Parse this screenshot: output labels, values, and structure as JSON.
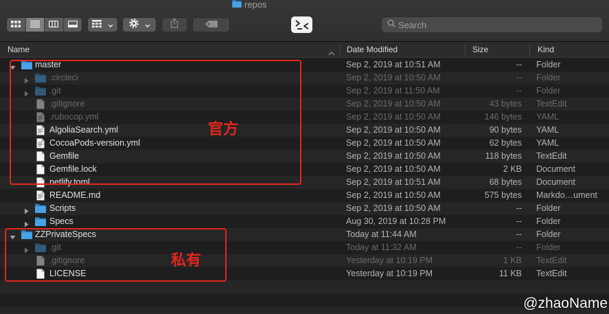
{
  "window": {
    "title": "repos",
    "title_icon": "folder-icon"
  },
  "toolbar": {
    "view_modes": [
      {
        "icon": "icon-view-icon",
        "selected": false
      },
      {
        "icon": "list-view-icon",
        "selected": true
      },
      {
        "icon": "column-view-icon",
        "selected": false
      },
      {
        "icon": "gallery-view-icon",
        "selected": false
      }
    ],
    "group_icon": "group-icon",
    "action_icon": "gear-icon",
    "share_icon": "share-icon",
    "share_enabled": false,
    "tag_icon": "tag-icon",
    "tag_enabled": false,
    "extension_icon": "terminal-icon",
    "search_icon": "search-icon",
    "search_placeholder": "Search"
  },
  "columns": {
    "name": "Name",
    "date_modified": "Date Modified",
    "size": "Size",
    "kind": "Kind",
    "sort_icon": "chevron-up-icon"
  },
  "rows": [
    {
      "level": 0,
      "disclosure_icon": "disclosure-expanded-icon",
      "icon": "folder-icon",
      "hidden": false,
      "name": "master",
      "date_modified": "Sep 2, 2019 at 10:51 AM",
      "size": "--",
      "kind": "Folder"
    },
    {
      "level": 1,
      "disclosure_icon": "disclosure-collapsed-icon",
      "icon": "folder-icon",
      "hidden": true,
      "name": ".circleci",
      "date_modified": "Sep 2, 2019 at 10:50 AM",
      "size": "--",
      "kind": "Folder"
    },
    {
      "level": 1,
      "disclosure_icon": "disclosure-collapsed-icon",
      "icon": "folder-icon",
      "hidden": true,
      "name": ".git",
      "date_modified": "Sep 2, 2019 at 11:50 AM",
      "size": "--",
      "kind": "Folder"
    },
    {
      "level": 1,
      "disclosure_icon": null,
      "icon": "document-icon",
      "hidden": true,
      "name": ".gitignore",
      "date_modified": "Sep 2, 2019 at 10:50 AM",
      "size": "43 bytes",
      "kind": "TextEdit"
    },
    {
      "level": 1,
      "disclosure_icon": null,
      "icon": "document-preview-icon",
      "hidden": true,
      "name": ".rubocop.yml",
      "date_modified": "Sep 2, 2019 at 10:50 AM",
      "size": "146 bytes",
      "kind": "YAML"
    },
    {
      "level": 1,
      "disclosure_icon": null,
      "icon": "document-preview-icon",
      "hidden": false,
      "name": "AlgoliaSearch.yml",
      "date_modified": "Sep 2, 2019 at 10:50 AM",
      "size": "90 bytes",
      "kind": "YAML"
    },
    {
      "level": 1,
      "disclosure_icon": null,
      "icon": "document-preview-icon",
      "hidden": false,
      "name": "CocoaPods-version.yml",
      "date_modified": "Sep 2, 2019 at 10:50 AM",
      "size": "62 bytes",
      "kind": "YAML"
    },
    {
      "level": 1,
      "disclosure_icon": null,
      "icon": "document-icon",
      "hidden": false,
      "name": "Gemfile",
      "date_modified": "Sep 2, 2019 at 10:50 AM",
      "size": "118 bytes",
      "kind": "TextEdit"
    },
    {
      "level": 1,
      "disclosure_icon": null,
      "icon": "document-icon",
      "hidden": false,
      "name": "Gemfile.lock",
      "date_modified": "Sep 2, 2019 at 10:50 AM",
      "size": "2 KB",
      "kind": "Document"
    },
    {
      "level": 1,
      "disclosure_icon": null,
      "icon": "document-icon",
      "hidden": false,
      "name": "netlify.toml",
      "date_modified": "Sep 2, 2019 at 10:51 AM",
      "size": "68 bytes",
      "kind": "Document"
    },
    {
      "level": 1,
      "disclosure_icon": null,
      "icon": "document-preview-icon",
      "hidden": false,
      "name": "README.md",
      "date_modified": "Sep 2, 2019 at 10:50 AM",
      "size": "575 bytes",
      "kind": "Markdo…ument"
    },
    {
      "level": 1,
      "disclosure_icon": "disclosure-collapsed-icon",
      "icon": "folder-icon",
      "hidden": false,
      "name": "Scripts",
      "date_modified": "Sep 2, 2019 at 10:50 AM",
      "size": "--",
      "kind": "Folder"
    },
    {
      "level": 1,
      "disclosure_icon": "disclosure-collapsed-icon",
      "icon": "folder-icon",
      "hidden": false,
      "name": "Specs",
      "date_modified": "Aug 30, 2019 at 10:28 PM",
      "size": "--",
      "kind": "Folder"
    },
    {
      "level": 0,
      "disclosure_icon": "disclosure-expanded-icon",
      "icon": "folder-icon",
      "hidden": false,
      "name": "ZZPrivateSpecs",
      "date_modified": "Today at 11:44 AM",
      "size": "--",
      "kind": "Folder"
    },
    {
      "level": 1,
      "disclosure_icon": "disclosure-collapsed-icon",
      "icon": "folder-icon",
      "hidden": true,
      "name": ".git",
      "date_modified": "Today at 11:32 AM",
      "size": "--",
      "kind": "Folder"
    },
    {
      "level": 1,
      "disclosure_icon": null,
      "icon": "document-icon",
      "hidden": true,
      "name": ".gitignore",
      "date_modified": "Yesterday at 10:19 PM",
      "size": "1 KB",
      "kind": "TextEdit"
    },
    {
      "level": 1,
      "disclosure_icon": null,
      "icon": "document-icon",
      "hidden": false,
      "name": "LICENSE",
      "date_modified": "Yesterday at 10:19 PM",
      "size": "11 KB",
      "kind": "TextEdit"
    }
  ],
  "annotations": [
    {
      "label": "官方"
    },
    {
      "label": "私有"
    }
  ],
  "watermark": "@zhaoName",
  "colors": {
    "annotation": "#e3261e",
    "folder": "#4aa2e6",
    "folder_tab": "#2f82c7"
  }
}
